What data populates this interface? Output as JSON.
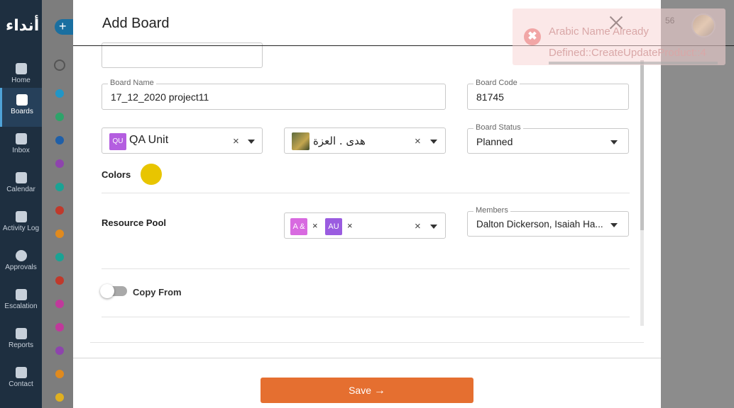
{
  "app": {
    "logo_text": "أنداء"
  },
  "sidebar": {
    "items": [
      {
        "label": "Home",
        "icon": "clipboard-icon"
      },
      {
        "label": "Boards",
        "icon": "grid-icon",
        "active": true
      },
      {
        "label": "Inbox",
        "icon": "inbox-icon"
      },
      {
        "label": "Calendar",
        "icon": "calendar-icon"
      },
      {
        "label": "Activity Log",
        "icon": "list-icon"
      },
      {
        "label": "Approvals",
        "icon": "check-circle-icon"
      },
      {
        "label": "Escalation",
        "icon": "mail-icon"
      },
      {
        "label": "Reports",
        "icon": "report-icon"
      },
      {
        "label": "Contact",
        "icon": "contact-card-icon"
      }
    ]
  },
  "background": {
    "header_number": "56",
    "dot_colors": [
      "#2196c7",
      "#2ea36a",
      "#1f5fa8",
      "#8e44ad",
      "#1aa394",
      "#c0392b",
      "#e08a1e",
      "#1aa394",
      "#c0392b",
      "#c0399b",
      "#c0399b",
      "#8e44ad",
      "#e08a1e",
      "#e0b020"
    ]
  },
  "modal": {
    "title": "Add Board",
    "board_name": {
      "label": "Board Name",
      "value": "17_12_2020 project11"
    },
    "board_code": {
      "label": "Board Code",
      "value": "81745"
    },
    "unit_select": {
      "chip": "QU",
      "value": "QA Unit",
      "clear": "×"
    },
    "owner_select": {
      "value": "هدى . العزة",
      "clear": "×"
    },
    "board_status": {
      "label": "Board Status",
      "value": "Planned"
    },
    "colors": {
      "label": "Colors",
      "selected": "#e8c500"
    },
    "resource_pool": {
      "label": "Resource Pool",
      "chips": [
        {
          "text": "A &",
          "color": "#d86ae0",
          "remove": "×"
        },
        {
          "text": "AU",
          "color": "#9a5ce0",
          "remove": "×"
        }
      ],
      "clear": "×"
    },
    "members": {
      "label": "Members",
      "value": "Dalton Dickerson, Isaiah Ha..."
    },
    "copy_from": {
      "label": "Copy From",
      "checked": false
    },
    "save": {
      "label": "Save",
      "arrow": "→"
    }
  },
  "toast": {
    "icon": "✖",
    "line1": "Arabic Name Already",
    "line2": "Defined::CreateUpdateProduct::4"
  }
}
